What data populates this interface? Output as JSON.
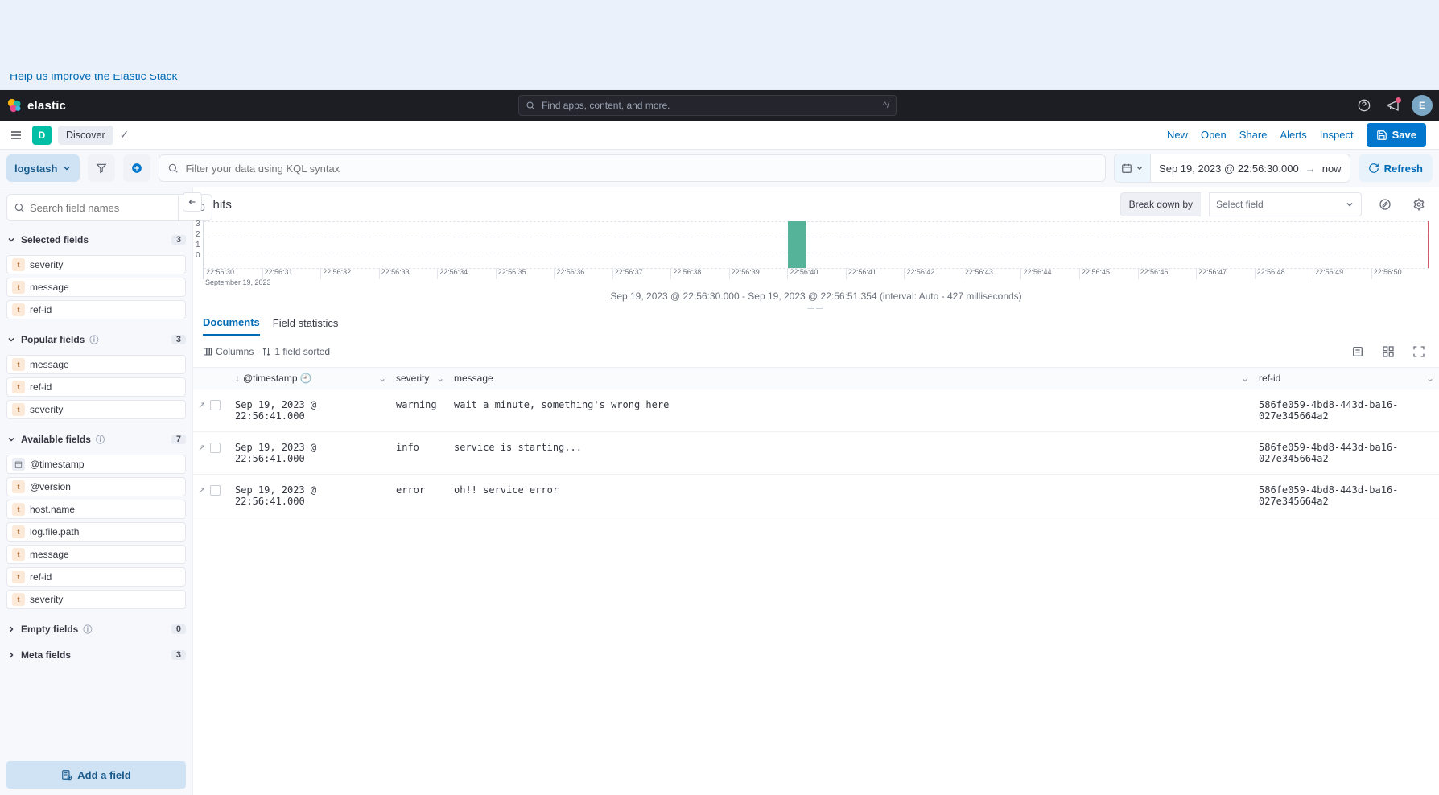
{
  "banner": {
    "msg": "Help us improve the Elastic Stack"
  },
  "brand": "elastic",
  "search_placeholder": "Find apps, content, and more.",
  "avatar_initial": "E",
  "space_initial": "D",
  "breadcrumb": "Discover",
  "nav": {
    "new": "New",
    "open": "Open",
    "share": "Share",
    "alerts": "Alerts",
    "inspect": "Inspect",
    "save": "Save"
  },
  "dataview": "logstash",
  "kql_placeholder": "Filter your data using KQL syntax",
  "date": {
    "from": "Sep 19, 2023 @ 22:56:30.000",
    "to": "now"
  },
  "refresh": "Refresh",
  "sidebar": {
    "search_placeholder": "Search field names",
    "filter_count": "0",
    "selected": {
      "label": "Selected fields",
      "count": "3",
      "items": [
        "severity",
        "message",
        "ref-id"
      ]
    },
    "popular": {
      "label": "Popular fields",
      "count": "3",
      "items": [
        "message",
        "ref-id",
        "severity"
      ]
    },
    "available": {
      "label": "Available fields",
      "count": "7",
      "items": [
        "@timestamp",
        "@version",
        "host.name",
        "log.file.path",
        "message",
        "ref-id",
        "severity"
      ]
    },
    "empty": {
      "label": "Empty fields",
      "count": "0"
    },
    "meta": {
      "label": "Meta fields",
      "count": "3"
    },
    "add_field": "Add a field"
  },
  "hits": {
    "count": "3",
    "suffix": " hits"
  },
  "breakdown": {
    "label": "Break down by",
    "placeholder": "Select field"
  },
  "range_caption": "Sep 19, 2023 @ 22:56:30.000 - Sep 19, 2023 @ 22:56:51.354 (interval: Auto - 427 milliseconds)",
  "tabs": {
    "documents": "Documents",
    "stats": "Field statistics"
  },
  "tctrl": {
    "columns": "Columns",
    "sorted": "1 field sorted"
  },
  "columns": {
    "ts": "@timestamp",
    "sev": "severity",
    "msg": "message",
    "ref": "ref-id"
  },
  "rows": [
    {
      "ts": "Sep 19, 2023 @ 22:56:41.000",
      "sev": "warning",
      "msg": "wait a minute, something's wrong here",
      "ref": "586fe059-4bd8-443d-ba16-027e345664a2"
    },
    {
      "ts": "Sep 19, 2023 @ 22:56:41.000",
      "sev": "info",
      "msg": "service is starting...",
      "ref": "586fe059-4bd8-443d-ba16-027e345664a2"
    },
    {
      "ts": "Sep 19, 2023 @ 22:56:41.000",
      "sev": "error",
      "msg": "oh!! service error",
      "ref": "586fe059-4bd8-443d-ba16-027e345664a2"
    }
  ],
  "chart_data": {
    "type": "bar",
    "ylabel": "",
    "xlabel": "",
    "ylim": [
      0,
      3
    ],
    "yticks": [
      3,
      2,
      1,
      0
    ],
    "categories": [
      "22:56:30",
      "22:56:31",
      "22:56:32",
      "22:56:33",
      "22:56:34",
      "22:56:35",
      "22:56:36",
      "22:56:37",
      "22:56:38",
      "22:56:39",
      "22:56:40",
      "22:56:41",
      "22:56:42",
      "22:56:43",
      "22:56:44",
      "22:56:45",
      "22:56:46",
      "22:56:47",
      "22:56:48",
      "22:56:49",
      "22:56:50"
    ],
    "values": [
      0,
      0,
      0,
      0,
      0,
      0,
      0,
      0,
      0,
      0,
      3,
      0,
      0,
      0,
      0,
      0,
      0,
      0,
      0,
      0,
      0
    ],
    "subdate": "September 19, 2023"
  }
}
